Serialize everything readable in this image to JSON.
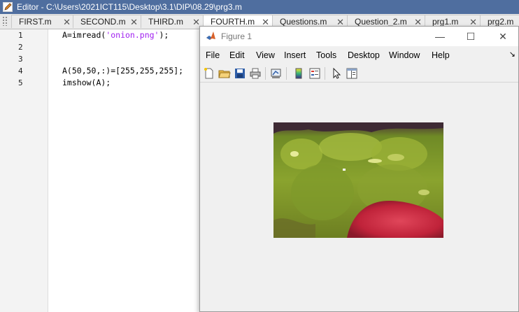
{
  "editor": {
    "title": "Editor - C:\\Users\\2021ICT115\\Desktop\\3.1\\DIP\\08.29\\prg3.m",
    "tabs": [
      {
        "label": "FIRST.m"
      },
      {
        "label": "SECOND.m"
      },
      {
        "label": "THIRD.m"
      },
      {
        "label": "FOURTH.m"
      },
      {
        "label": "Questions.m"
      },
      {
        "label": "Question_2.m"
      },
      {
        "label": "prg1.m"
      },
      {
        "label": "prg2.m"
      }
    ],
    "line_numbers": [
      "1",
      "2",
      "3",
      "4",
      "5"
    ],
    "code": {
      "line1_pre": "A=imread(",
      "line1_str": "'onion.png'",
      "line1_post": ");",
      "line4": "A(50,50,:)=[255,255,255];",
      "line5": "imshow(A);"
    }
  },
  "figure": {
    "title": "Figure 1",
    "menu": [
      "File",
      "Edit",
      "View",
      "Insert",
      "Tools",
      "Desktop",
      "Window",
      "Help"
    ],
    "menu_overflow": "↘",
    "window_controls": {
      "minimize": "—",
      "maximize": "☐",
      "close": "✕"
    },
    "toolbar_icons": [
      "new-figure-icon",
      "open-file-icon",
      "save-icon",
      "print-icon",
      "link-plot-icon",
      "colorbar-icon",
      "legend-icon",
      "edit-plot-icon",
      "property-inspector-icon"
    ]
  },
  "colors": {
    "editor_titlebar": "#4f6e9f",
    "string_literal": "#a020f0"
  }
}
